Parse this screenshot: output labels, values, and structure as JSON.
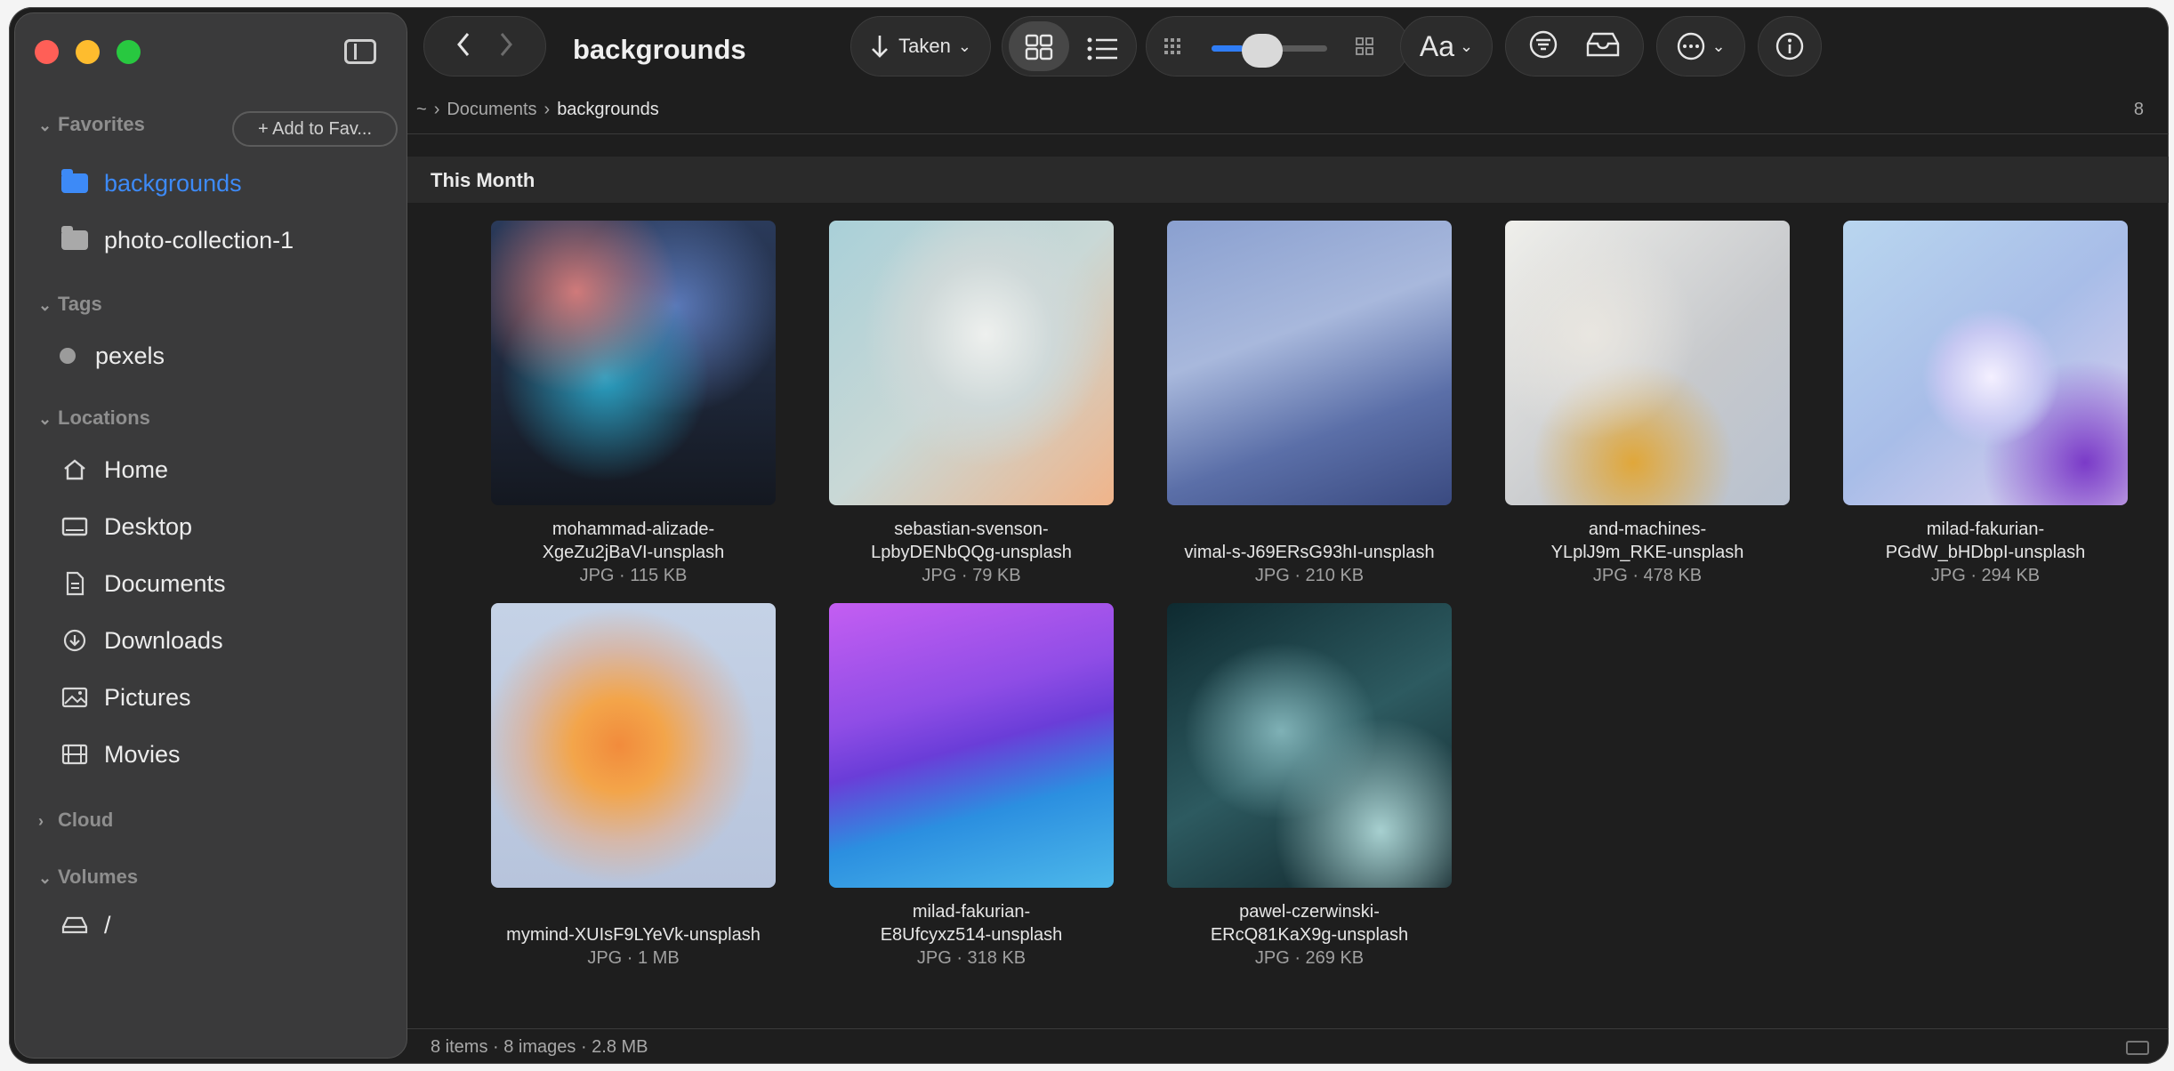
{
  "window": {
    "title": "backgrounds"
  },
  "sidebar": {
    "favorites_header": "Favorites",
    "add_to_favorites": "Add to Fav...",
    "favorites": [
      {
        "label": "backgrounds",
        "active": true
      },
      {
        "label": "photo-collection-1",
        "active": false
      }
    ],
    "tags_header": "Tags",
    "tags": [
      {
        "label": "pexels"
      }
    ],
    "locations_header": "Locations",
    "locations": [
      {
        "label": "Home",
        "icon": "house-icon"
      },
      {
        "label": "Desktop",
        "icon": "display-icon"
      },
      {
        "label": "Documents",
        "icon": "document-icon"
      },
      {
        "label": "Downloads",
        "icon": "download-icon"
      },
      {
        "label": "Pictures",
        "icon": "photo-icon"
      },
      {
        "label": "Movies",
        "icon": "film-icon"
      }
    ],
    "cloud_header": "Cloud",
    "volumes_header": "Volumes",
    "volumes": [
      {
        "label": "/"
      }
    ]
  },
  "toolbar": {
    "sort_label": "Taken",
    "font_label": "Aa"
  },
  "pathbar": {
    "root": "~",
    "segments": [
      "Documents",
      "backgrounds"
    ],
    "count": "8"
  },
  "group": {
    "title": "This Month"
  },
  "files": [
    {
      "name_line1": "mohammad-alizade-",
      "name_line2": "XgeZu2jBaVI-unsplash",
      "meta": "JPG · 115 KB"
    },
    {
      "name_line1": "sebastian-svenson-",
      "name_line2": "LpbyDENbQQg-unsplash",
      "meta": "JPG · 79 KB"
    },
    {
      "name_line1": "",
      "name_line2": "vimal-s-J69ERsG93hI-unsplash",
      "meta": "JPG · 210 KB"
    },
    {
      "name_line1": "and-machines-",
      "name_line2": "YLplJ9m_RKE-unsplash",
      "meta": "JPG · 478 KB"
    },
    {
      "name_line1": "milad-fakurian-",
      "name_line2": "PGdW_bHDbpI-unsplash",
      "meta": "JPG · 294 KB"
    },
    {
      "name_line1": "",
      "name_line2": "mymind-XUIsF9LYeVk-unsplash",
      "meta": "JPG · 1 MB"
    },
    {
      "name_line1": "milad-fakurian-",
      "name_line2": "E8Ufcyxz514-unsplash",
      "meta": "JPG · 318 KB"
    },
    {
      "name_line1": "pawel-czerwinski-",
      "name_line2": "ERcQ81KaX9g-unsplash",
      "meta": "JPG · 269 KB"
    }
  ],
  "status": {
    "text": "8 items · 8 images · 2.8 MB"
  },
  "colors": {
    "accent": "#3d8af7",
    "background": "#1e1e1e",
    "sidebar": "#3a3a3b"
  }
}
